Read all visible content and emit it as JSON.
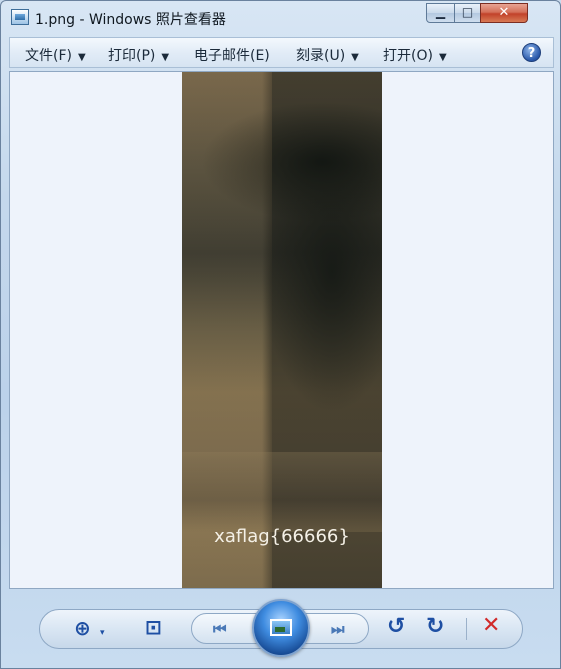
{
  "window": {
    "title": "1.png - Windows 照片查看器",
    "minimize_glyph": "▁",
    "maximize_glyph": "□",
    "close_glyph": "✕"
  },
  "menu": {
    "items": [
      {
        "label": "文件(F)",
        "has_dropdown": true
      },
      {
        "label": "打印(P)",
        "has_dropdown": true
      },
      {
        "label": "电子邮件(E)",
        "has_dropdown": false
      },
      {
        "label": "刻录(U)",
        "has_dropdown": true
      },
      {
        "label": "打开(O)",
        "has_dropdown": true
      }
    ],
    "help_glyph": "?"
  },
  "image": {
    "overlay_text": "xaflag{66666}"
  },
  "toolbar": {
    "tooltip_text": "",
    "icons": {
      "zoom": "zoom-icon",
      "fit": "actual-size-icon",
      "prev": "previous-icon",
      "slideshow": "slideshow-icon",
      "next": "next-icon",
      "rotate_left": "rotate-counterclockwise-icon",
      "rotate_right": "rotate-clockwise-icon",
      "delete": "delete-icon"
    },
    "glyphs": {
      "zoom": "⊕",
      "zoom_caret": "▾",
      "fit": "⊡",
      "prev": "⏮",
      "next": "⏭",
      "rotate_left": "↺",
      "rotate_right": "↻",
      "delete": "✕"
    },
    "colors": {
      "icon_blue": "#1e4fa3",
      "delete_red": "#d12a2a"
    }
  }
}
